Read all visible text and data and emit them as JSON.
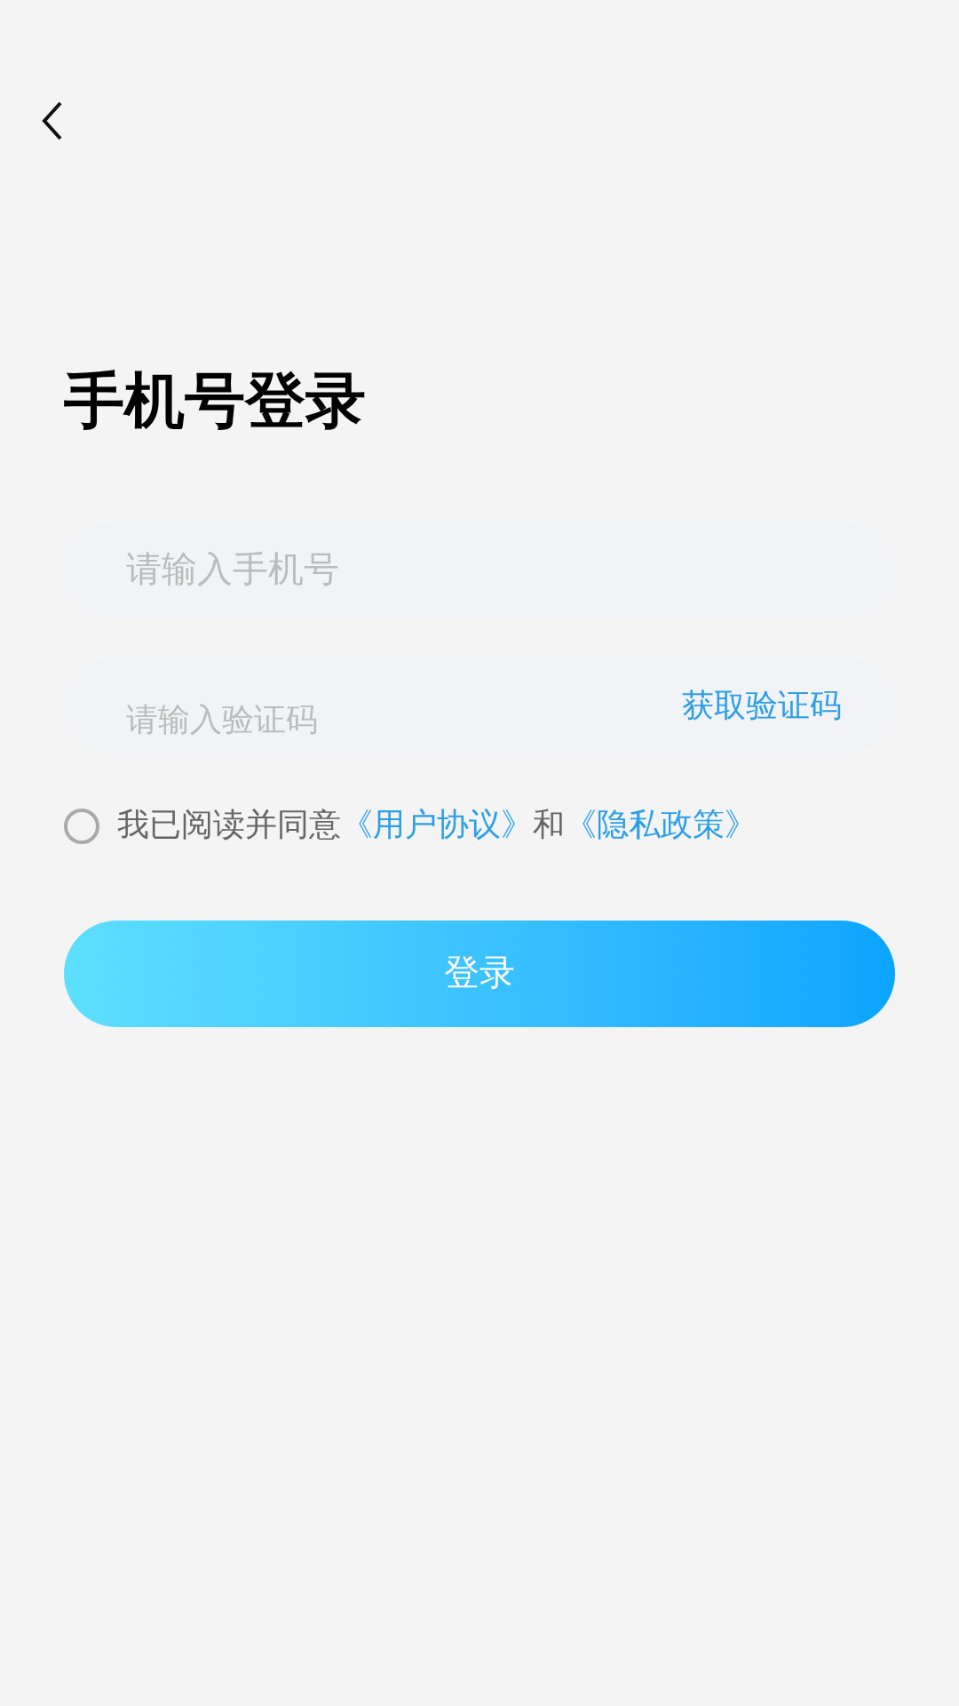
{
  "title": "手机号登录",
  "phone_field": {
    "placeholder": "请输入手机号"
  },
  "code_field": {
    "placeholder": "请输入验证码",
    "action": "获取验证码"
  },
  "agreement": {
    "checked": false,
    "parts": [
      {
        "kind": "text",
        "text": "我已阅读并同意"
      },
      {
        "kind": "link",
        "text": "《用户协议》"
      },
      {
        "kind": "text",
        "text": "和"
      },
      {
        "kind": "link",
        "text": "《隐私政策》"
      }
    ]
  },
  "login_button": "登录"
}
